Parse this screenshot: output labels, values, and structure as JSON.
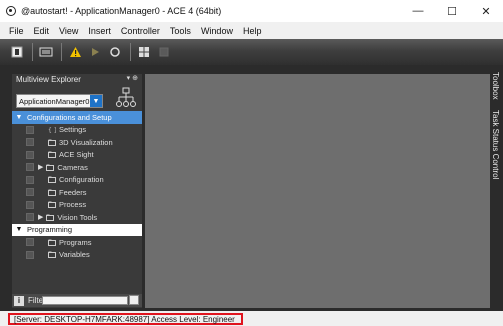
{
  "window": {
    "title": "@autostart! - ApplicationManager0 - ACE 4 (64bit)",
    "minimize_glyph": "—",
    "maximize_glyph": "☐",
    "close_glyph": "✕"
  },
  "menu": [
    "File",
    "Edit",
    "View",
    "Insert",
    "Controller",
    "Tools",
    "Window",
    "Help"
  ],
  "toolbar": {
    "icons": [
      "stop-icon",
      "keyboard-icon",
      "warning-icon",
      "run-icon",
      "refresh-icon",
      "grid-icon",
      "disabled-icon"
    ]
  },
  "explorer": {
    "header": "Multiview Explorer",
    "pin_glyphs": "▾ ⊕",
    "app_selector": "ApplicationManager0",
    "tree": [
      {
        "label": "Configurations and Setup",
        "type": "group",
        "expanded": true
      },
      {
        "label": "Settings",
        "type": "leaf",
        "indent": 2
      },
      {
        "label": "3D Visualization",
        "type": "leaf",
        "indent": 2
      },
      {
        "label": "ACE Sight",
        "type": "leaf",
        "indent": 2
      },
      {
        "label": "Cameras",
        "type": "branch",
        "indent": 1
      },
      {
        "label": "Configuration",
        "type": "leaf",
        "indent": 2
      },
      {
        "label": "Feeders",
        "type": "leaf",
        "indent": 2
      },
      {
        "label": "Process",
        "type": "leaf",
        "indent": 2
      },
      {
        "label": "Vision Tools",
        "type": "branch",
        "indent": 1
      },
      {
        "label": "Programming",
        "type": "group",
        "expanded": true
      },
      {
        "label": "Programs",
        "type": "leaf",
        "indent": 2
      },
      {
        "label": "Variables",
        "type": "leaf",
        "indent": 2
      }
    ],
    "filter_label": "Filter"
  },
  "side_tabs": [
    "Toolbox",
    "Task Status Control"
  ],
  "status": {
    "text": "[Server: DESKTOP-H7MFARK:48987] Access Level: Engineer",
    "highlight_color": "#e0141e"
  },
  "colors": {
    "accent": "#4a90d9",
    "panel": "#3a3a3a",
    "workspace": "#6e6e6e"
  }
}
